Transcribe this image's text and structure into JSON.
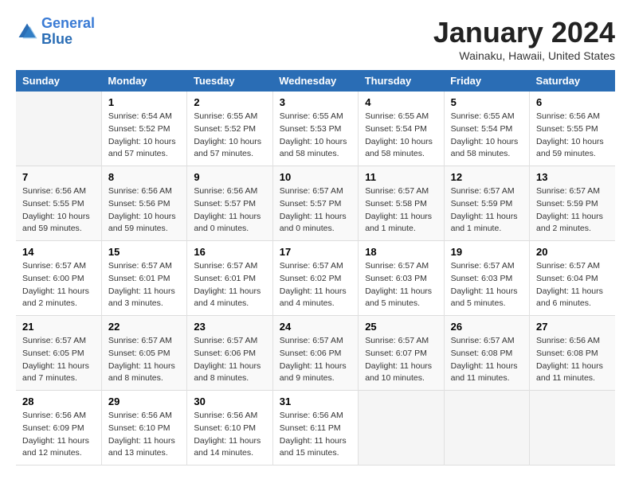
{
  "header": {
    "logo_line1": "General",
    "logo_line2": "Blue",
    "month": "January 2024",
    "location": "Wainaku, Hawaii, United States"
  },
  "weekdays": [
    "Sunday",
    "Monday",
    "Tuesday",
    "Wednesday",
    "Thursday",
    "Friday",
    "Saturday"
  ],
  "weeks": [
    [
      {
        "day": "",
        "info": ""
      },
      {
        "day": "1",
        "info": "Sunrise: 6:54 AM\nSunset: 5:52 PM\nDaylight: 10 hours\nand 57 minutes."
      },
      {
        "day": "2",
        "info": "Sunrise: 6:55 AM\nSunset: 5:52 PM\nDaylight: 10 hours\nand 57 minutes."
      },
      {
        "day": "3",
        "info": "Sunrise: 6:55 AM\nSunset: 5:53 PM\nDaylight: 10 hours\nand 58 minutes."
      },
      {
        "day": "4",
        "info": "Sunrise: 6:55 AM\nSunset: 5:54 PM\nDaylight: 10 hours\nand 58 minutes."
      },
      {
        "day": "5",
        "info": "Sunrise: 6:55 AM\nSunset: 5:54 PM\nDaylight: 10 hours\nand 58 minutes."
      },
      {
        "day": "6",
        "info": "Sunrise: 6:56 AM\nSunset: 5:55 PM\nDaylight: 10 hours\nand 59 minutes."
      }
    ],
    [
      {
        "day": "7",
        "info": "Sunrise: 6:56 AM\nSunset: 5:55 PM\nDaylight: 10 hours\nand 59 minutes."
      },
      {
        "day": "8",
        "info": "Sunrise: 6:56 AM\nSunset: 5:56 PM\nDaylight: 10 hours\nand 59 minutes."
      },
      {
        "day": "9",
        "info": "Sunrise: 6:56 AM\nSunset: 5:57 PM\nDaylight: 11 hours\nand 0 minutes."
      },
      {
        "day": "10",
        "info": "Sunrise: 6:57 AM\nSunset: 5:57 PM\nDaylight: 11 hours\nand 0 minutes."
      },
      {
        "day": "11",
        "info": "Sunrise: 6:57 AM\nSunset: 5:58 PM\nDaylight: 11 hours\nand 1 minute."
      },
      {
        "day": "12",
        "info": "Sunrise: 6:57 AM\nSunset: 5:59 PM\nDaylight: 11 hours\nand 1 minute."
      },
      {
        "day": "13",
        "info": "Sunrise: 6:57 AM\nSunset: 5:59 PM\nDaylight: 11 hours\nand 2 minutes."
      }
    ],
    [
      {
        "day": "14",
        "info": "Sunrise: 6:57 AM\nSunset: 6:00 PM\nDaylight: 11 hours\nand 2 minutes."
      },
      {
        "day": "15",
        "info": "Sunrise: 6:57 AM\nSunset: 6:01 PM\nDaylight: 11 hours\nand 3 minutes."
      },
      {
        "day": "16",
        "info": "Sunrise: 6:57 AM\nSunset: 6:01 PM\nDaylight: 11 hours\nand 4 minutes."
      },
      {
        "day": "17",
        "info": "Sunrise: 6:57 AM\nSunset: 6:02 PM\nDaylight: 11 hours\nand 4 minutes."
      },
      {
        "day": "18",
        "info": "Sunrise: 6:57 AM\nSunset: 6:03 PM\nDaylight: 11 hours\nand 5 minutes."
      },
      {
        "day": "19",
        "info": "Sunrise: 6:57 AM\nSunset: 6:03 PM\nDaylight: 11 hours\nand 5 minutes."
      },
      {
        "day": "20",
        "info": "Sunrise: 6:57 AM\nSunset: 6:04 PM\nDaylight: 11 hours\nand 6 minutes."
      }
    ],
    [
      {
        "day": "21",
        "info": "Sunrise: 6:57 AM\nSunset: 6:05 PM\nDaylight: 11 hours\nand 7 minutes."
      },
      {
        "day": "22",
        "info": "Sunrise: 6:57 AM\nSunset: 6:05 PM\nDaylight: 11 hours\nand 8 minutes."
      },
      {
        "day": "23",
        "info": "Sunrise: 6:57 AM\nSunset: 6:06 PM\nDaylight: 11 hours\nand 8 minutes."
      },
      {
        "day": "24",
        "info": "Sunrise: 6:57 AM\nSunset: 6:06 PM\nDaylight: 11 hours\nand 9 minutes."
      },
      {
        "day": "25",
        "info": "Sunrise: 6:57 AM\nSunset: 6:07 PM\nDaylight: 11 hours\nand 10 minutes."
      },
      {
        "day": "26",
        "info": "Sunrise: 6:57 AM\nSunset: 6:08 PM\nDaylight: 11 hours\nand 11 minutes."
      },
      {
        "day": "27",
        "info": "Sunrise: 6:56 AM\nSunset: 6:08 PM\nDaylight: 11 hours\nand 11 minutes."
      }
    ],
    [
      {
        "day": "28",
        "info": "Sunrise: 6:56 AM\nSunset: 6:09 PM\nDaylight: 11 hours\nand 12 minutes."
      },
      {
        "day": "29",
        "info": "Sunrise: 6:56 AM\nSunset: 6:10 PM\nDaylight: 11 hours\nand 13 minutes."
      },
      {
        "day": "30",
        "info": "Sunrise: 6:56 AM\nSunset: 6:10 PM\nDaylight: 11 hours\nand 14 minutes."
      },
      {
        "day": "31",
        "info": "Sunrise: 6:56 AM\nSunset: 6:11 PM\nDaylight: 11 hours\nand 15 minutes."
      },
      {
        "day": "",
        "info": ""
      },
      {
        "day": "",
        "info": ""
      },
      {
        "day": "",
        "info": ""
      }
    ]
  ]
}
